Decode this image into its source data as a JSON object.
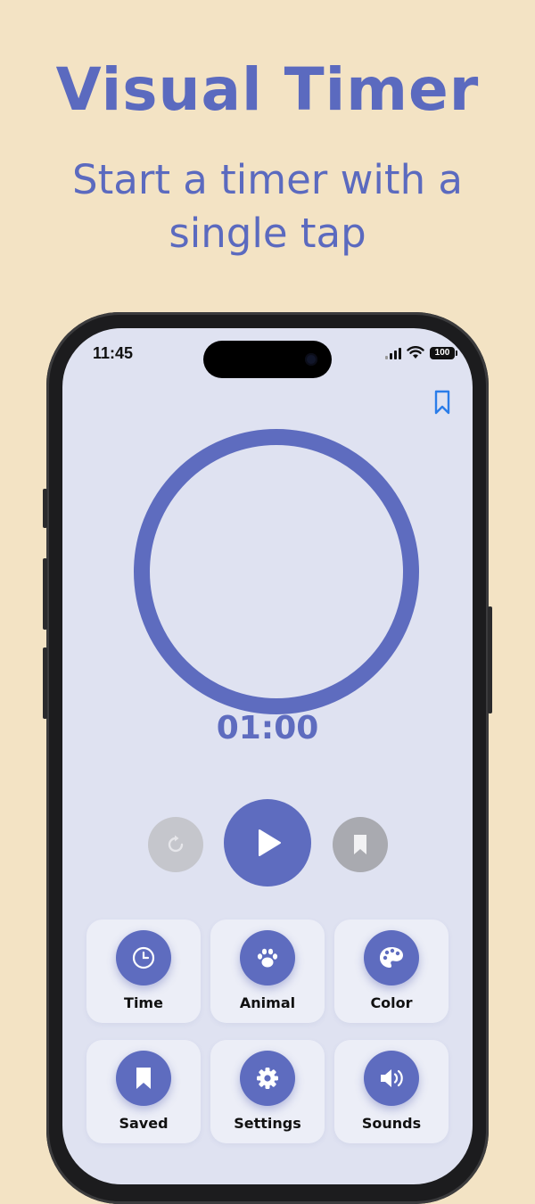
{
  "promo": {
    "title": "Visual Timer",
    "subtitle": "Start a timer with a single tap"
  },
  "status_bar": {
    "time": "11:45",
    "battery": "100"
  },
  "timer": {
    "display": "01:00"
  },
  "grid": {
    "items": [
      {
        "label": "Time",
        "icon": "clock-icon"
      },
      {
        "label": "Animal",
        "icon": "paw-icon"
      },
      {
        "label": "Color",
        "icon": "palette-icon"
      },
      {
        "label": "Saved",
        "icon": "bookmark-icon"
      },
      {
        "label": "Settings",
        "icon": "gear-icon"
      },
      {
        "label": "Sounds",
        "icon": "speaker-icon"
      }
    ]
  },
  "colors": {
    "background": "#f3e3c4",
    "accent": "#5e6cbf",
    "screen": "#dfe2f1",
    "bookmark_blue": "#2b7de9"
  }
}
